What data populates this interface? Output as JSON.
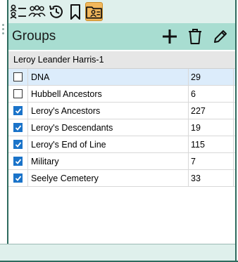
{
  "toolbar": {
    "buttons": [
      {
        "icon": "person-list-icon"
      },
      {
        "icon": "people-group-icon"
      },
      {
        "icon": "history-icon"
      },
      {
        "icon": "bookmark-icon"
      },
      {
        "icon": "groups-folder-icon",
        "active": true
      }
    ]
  },
  "header": {
    "title": "Groups",
    "add_icon": "plus-icon",
    "delete_icon": "trash-icon",
    "edit_icon": "pencil-icon"
  },
  "person": {
    "name": "Leroy Leander Harris-1"
  },
  "groups": [
    {
      "name": "DNA",
      "count": "29",
      "checked": false,
      "selected": true
    },
    {
      "name": "Hubbell Ancestors",
      "count": "6",
      "checked": false,
      "selected": false
    },
    {
      "name": "Leroy's Ancestors",
      "count": "227",
      "checked": true,
      "selected": false
    },
    {
      "name": "Leroy's Descendants",
      "count": "19",
      "checked": true,
      "selected": false
    },
    {
      "name": "Leroy's End of Line",
      "count": "115",
      "checked": true,
      "selected": false
    },
    {
      "name": "Military",
      "count": "7",
      "checked": true,
      "selected": false
    },
    {
      "name": "Seelye Cemetery",
      "count": "33",
      "checked": true,
      "selected": false
    }
  ],
  "colors": {
    "header_bg": "#a8ddd1",
    "toolbar_bg": "#dff0ec",
    "active_tab": "#f2b85c",
    "checkbox_checked": "#1a73c9",
    "selected_row": "#dcecfb"
  }
}
